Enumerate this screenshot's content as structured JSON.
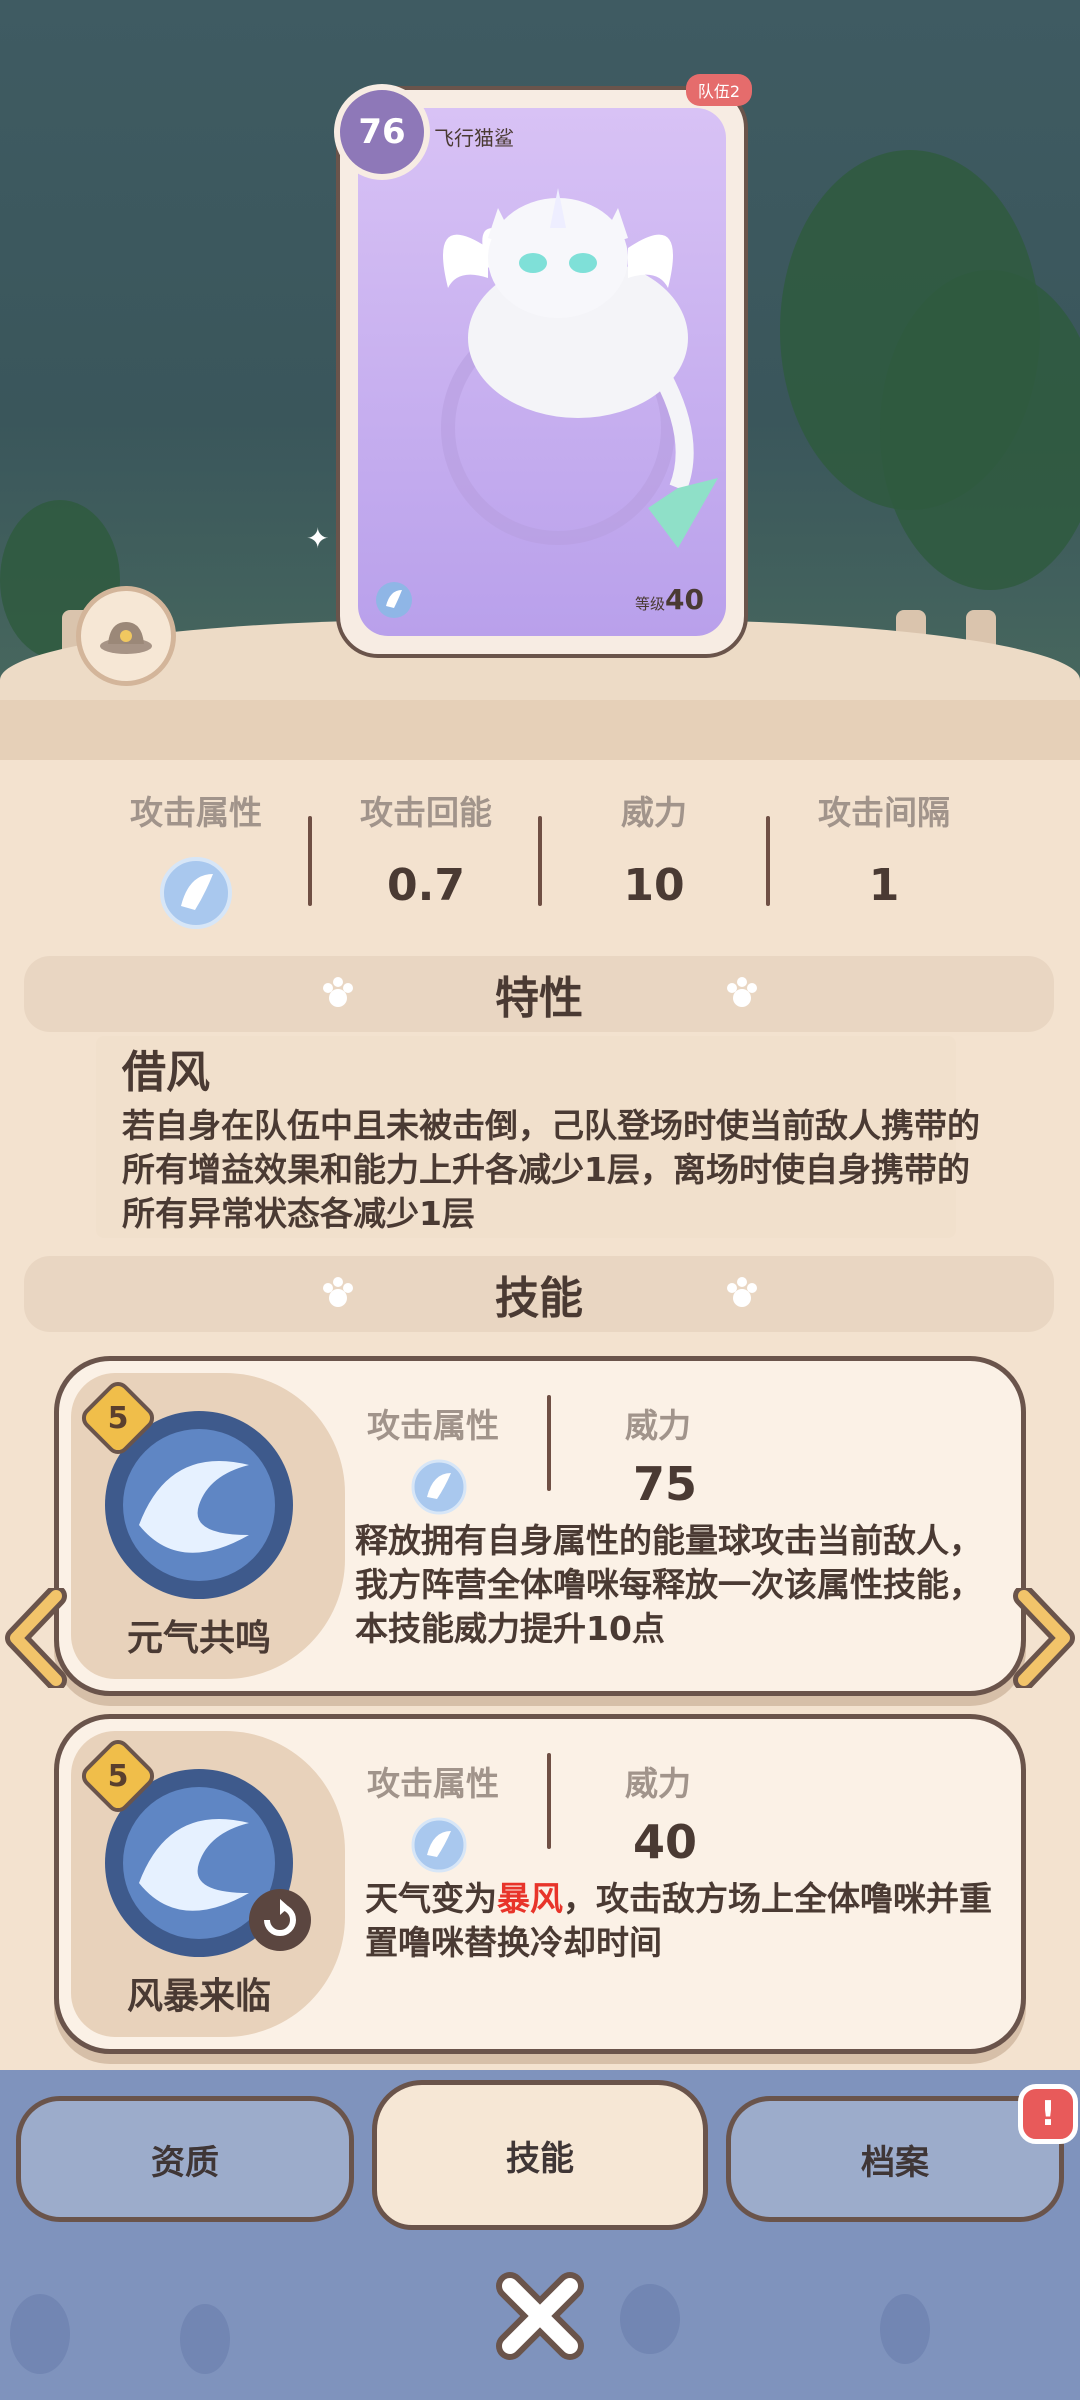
{
  "card": {
    "level_badge": "76",
    "name": "飞行猫鲨",
    "team_tag": "队伍2",
    "level_label": "等级",
    "level_value": "40"
  },
  "stats": [
    {
      "label": "攻击属性",
      "value": ""
    },
    {
      "label": "攻击回能",
      "value": "0.7"
    },
    {
      "label": "威力",
      "value": "10"
    },
    {
      "label": "攻击间隔",
      "value": "1"
    }
  ],
  "trait_section": {
    "title": "特性",
    "name": "借风",
    "description": "若自身在队伍中且未被击倒，己队登场时使当前敌人携带的所有增益效果和能力上升各减少1层，离场时使自身携带的所有异常状态各减少1层"
  },
  "skills_section": {
    "title": "技能",
    "skills": [
      {
        "name": "元气共鸣",
        "cost": "5",
        "attr_label": "攻击属性",
        "power_label": "威力",
        "power": "75",
        "description": "释放拥有自身属性的能量球攻击当前敌人，我方阵营全体噜咪每释放一次该属性技能，本技能威力提升10点"
      },
      {
        "name": "风暴来临",
        "cost": "5",
        "attr_label": "攻击属性",
        "power_label": "威力",
        "power": "40",
        "desc_pre": "天气变为",
        "desc_highlight": "暴风",
        "desc_post": "，攻击敌方场上全体噜咪并重置噜咪替换冷却时间"
      }
    ]
  },
  "tabs": [
    {
      "label": "资质"
    },
    {
      "label": "技能"
    },
    {
      "label": "档案"
    }
  ],
  "alert_badge": "!",
  "colors": {
    "accent": "#e8342a",
    "nav_bg": "#7f93bd",
    "card_purple": "#c4acef"
  }
}
